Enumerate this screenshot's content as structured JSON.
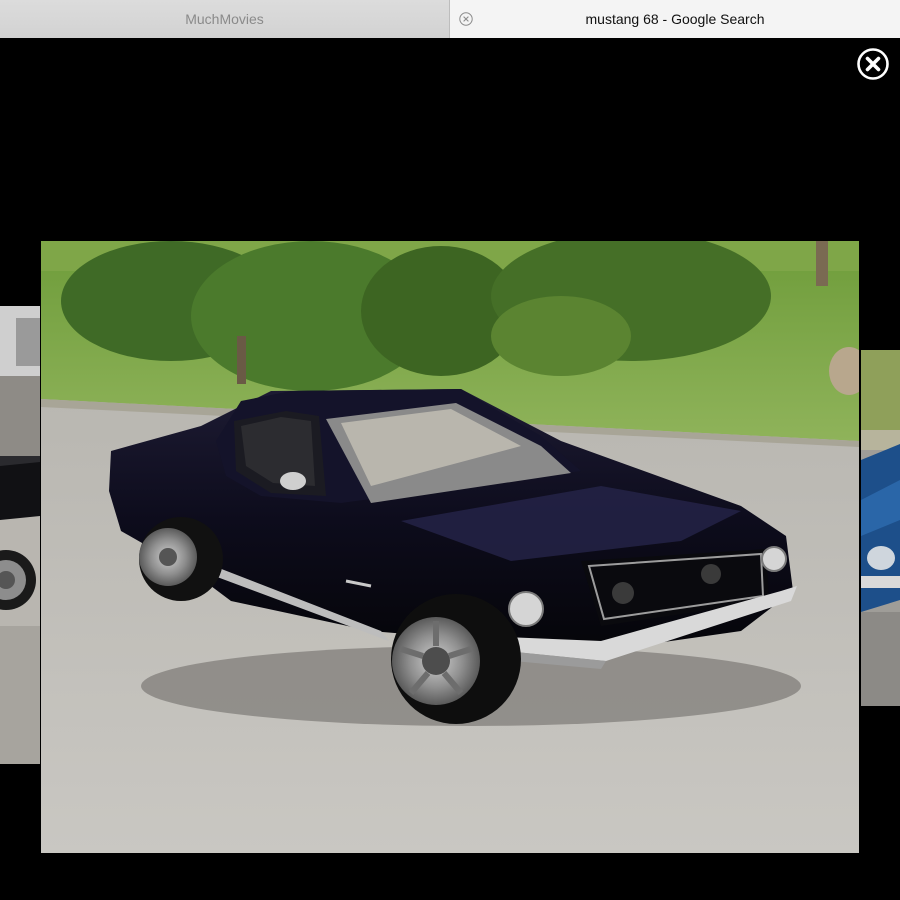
{
  "tabs": [
    {
      "title": "MuchMovies",
      "active": false
    },
    {
      "title": "mustang 68 - Google Search",
      "active": true
    }
  ],
  "icons": {
    "tab_close": "circle-x-icon",
    "viewer_close": "close-circle-icon"
  },
  "viewer": {
    "main_image": "black-1968-ford-mustang-fastback-photo",
    "left_neighbor": "black-mustang-partial-photo",
    "right_neighbor": "blue-mustang-partial-photo"
  },
  "colors": {
    "tabbar_bg": "#d9d9d9",
    "active_tab_bg": "#f4f4f4",
    "viewer_bg": "#000000"
  }
}
